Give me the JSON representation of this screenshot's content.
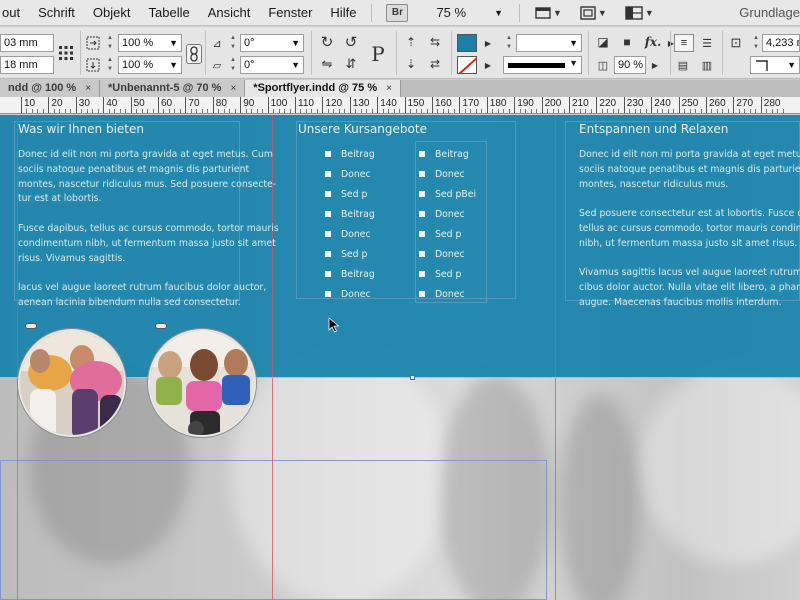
{
  "menu": {
    "items": [
      "out",
      "Schrift",
      "Objekt",
      "Tabelle",
      "Ansicht",
      "Fenster",
      "Hilfe"
    ],
    "bridge_badge": "Br",
    "zoom": "75 %",
    "workspace": "Grundlage"
  },
  "control": {
    "x_value": "03 mm",
    "y_value": "18 mm",
    "scale_x": "100 %",
    "scale_y": "100 %",
    "rotate": "0°",
    "shear": "0°",
    "stroke_weight": "",
    "opacity": "90 %",
    "spacing": "4,233 m",
    "fill_color": "#1b7fa8",
    "char_p": "P",
    "fx_label": "fx."
  },
  "tabs": [
    {
      "label": "ndd @ 100 %",
      "close": "×"
    },
    {
      "label": "*Unbenannt-5 @ 70 %",
      "close": "×"
    },
    {
      "label": "*Sportflyer.indd @ 75 %",
      "close": "×"
    }
  ],
  "ruler": {
    "labels": [
      "10",
      "20",
      "30",
      "40",
      "50",
      "60",
      "70",
      "80",
      "90",
      "100",
      "110",
      "120",
      "130",
      "140",
      "150",
      "160",
      "170",
      "180",
      "190",
      "200",
      "210",
      "220",
      "230",
      "240",
      "250",
      "260",
      "270",
      "280"
    ]
  },
  "document": {
    "col1": {
      "heading": "Was wir Ihnen bieten",
      "paragraphs": [
        [
          "Donec id elit non mi porta gravida at eget metus. Cum",
          "sociis natoque penatibus et magnis dis parturient",
          "montes, nascetur ridiculus mus. Sed posuere consecte-",
          "tur est at lobortis."
        ],
        [
          "Fusce dapibus, tellus ac cursus commodo, tortor mauris",
          "condimentum nibh, ut fermentum massa justo sit amet",
          "risus. Vivamus sagittis."
        ],
        [
          "lacus vel augue laoreet rutrum faucibus dolor auctor,",
          "aenean lacinia bibendum nulla sed consectetur."
        ]
      ]
    },
    "col2": {
      "heading": "Unsere Kursangebote",
      "list_a": [
        "Beitrag",
        "Donec",
        "Sed p",
        "Beitrag",
        "Donec",
        "Sed p",
        "Beitrag",
        "Donec"
      ],
      "list_b": [
        "Beitrag",
        "Donec",
        "Sed pBei",
        "Donec",
        "Sed p",
        "Donec",
        "Sed p",
        "Donec"
      ]
    },
    "col3": {
      "heading": "Entspannen und Relaxen",
      "paragraphs": [
        [
          "Donec id elit non mi porta gravida at eget metus. Cum",
          "sociis natoque penatibus et magnis dis parturient",
          "montes, nascetur ridiculus mus."
        ],
        [
          "Sed posuere consectetur est at lobortis. Fusce dapibus,",
          "tellus ac cursus commodo, tortor mauris condimentum",
          "nibh, ut fermentum massa justo sit amet risus."
        ],
        [
          "Vivamus sagittis lacus vel augue laoreet rutrum fau-",
          "cibus dolor auctor. Nulla vitae elit libero, a pharetra",
          "augue. Maecenas faucibus mollis interdum."
        ]
      ]
    },
    "band_color": "#1882ac"
  }
}
